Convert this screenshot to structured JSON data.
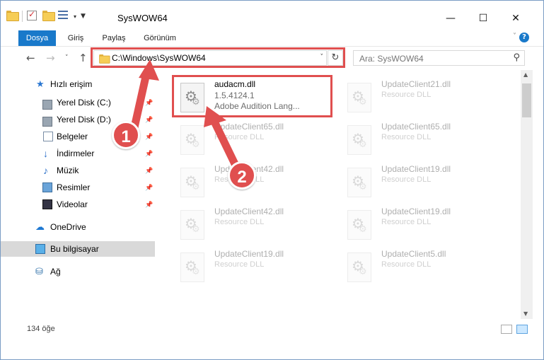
{
  "window": {
    "title": "SysWOW64",
    "minimize_glyph": "—",
    "maximize_glyph": "☐",
    "close_glyph": "✕"
  },
  "ribbon": {
    "tabs": [
      "Dosya",
      "Giriş",
      "Paylaş",
      "Görünüm"
    ]
  },
  "address": {
    "path": "C:\\Windows\\SysWOW64",
    "search_placeholder": "Ara: SysWOW64"
  },
  "nav": {
    "quick_access": "Hızlı erişim",
    "items": [
      {
        "label": "Yerel Disk (C:)",
        "icon": "drive-icon"
      },
      {
        "label": "Yerel Disk (D:)",
        "icon": "drive-icon"
      },
      {
        "label": "Belgeler",
        "icon": "documents-icon"
      },
      {
        "label": "İndirmeler",
        "icon": "downloads-icon"
      },
      {
        "label": "Müzik",
        "icon": "music-icon"
      },
      {
        "label": "Resimler",
        "icon": "pictures-icon"
      },
      {
        "label": "Videolar",
        "icon": "videos-icon"
      }
    ],
    "onedrive": "OneDrive",
    "this_pc": "Bu bilgisayar",
    "network": "Ağ"
  },
  "files": [
    {
      "name": "audacm.dll",
      "line2": "1.5.4124.1",
      "line3": "Adobe Audition Lang...",
      "highlight": true
    },
    {
      "name": "UpdateClient21.dll",
      "line2": "Resource DLL"
    },
    {
      "name": "UpdateClient65.dll",
      "line2": "Resource DLL"
    },
    {
      "name": "UpdateClient65.dll",
      "line2": "Resource DLL"
    },
    {
      "name": "UpdateClient42.dll",
      "line2": "Resource DLL"
    },
    {
      "name": "UpdateClient19.dll",
      "line2": "Resource DLL"
    },
    {
      "name": "UpdateClient42.dll",
      "line2": "Resource DLL"
    },
    {
      "name": "UpdateClient19.dll",
      "line2": "Resource DLL"
    },
    {
      "name": "UpdateClient19.dll",
      "line2": "Resource DLL"
    },
    {
      "name": "UpdateClient5.dll",
      "line2": "Resource DLL"
    }
  ],
  "status": {
    "count": "134 öğe"
  },
  "annotations": {
    "step1": "1",
    "step2": "2",
    "color": "#e04f4f"
  }
}
